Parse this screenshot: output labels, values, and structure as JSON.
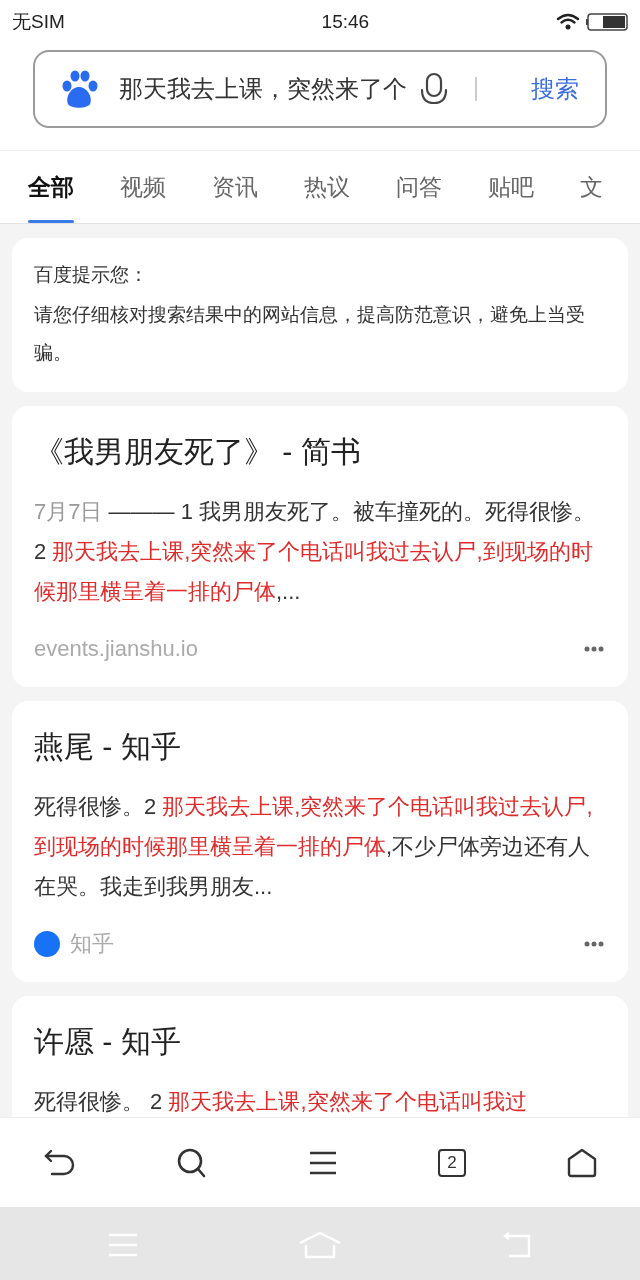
{
  "status_bar": {
    "carrier": "无SIM",
    "time": "15:46"
  },
  "search": {
    "value": "那天我去上课，突然来了个",
    "button": "搜索"
  },
  "tabs": [
    {
      "label": "全部",
      "selected": true
    },
    {
      "label": "视频",
      "selected": false
    },
    {
      "label": "资讯",
      "selected": false
    },
    {
      "label": "热议",
      "selected": false
    },
    {
      "label": "问答",
      "selected": false
    },
    {
      "label": "贴吧",
      "selected": false
    },
    {
      "label": "文",
      "selected": false
    }
  ],
  "notice": {
    "title": "百度提示您：",
    "text": "请您仔细核对搜索结果中的网站信息，提高防范意识，避免上当受骗。"
  },
  "results": [
    {
      "title": "《我男朋友死了》 - 简书",
      "snippet": [
        {
          "text": "7月7日 ",
          "kind": "date"
        },
        {
          "text": "——— 1 我男朋友死了。被车撞死的。死得很惨。2 ",
          "kind": "plain"
        },
        {
          "text": "那天我去上课,突然来了个电话叫我过去认尸,到现场的时候那里横呈着一排的尸体",
          "kind": "highlight"
        },
        {
          "text": ",...",
          "kind": "plain"
        }
      ],
      "source": {
        "kind": "url",
        "text": "events.jianshu.io"
      }
    },
    {
      "title": "燕尾 - 知乎",
      "snippet": [
        {
          "text": "死得很惨。2 ",
          "kind": "plain"
        },
        {
          "text": "那天我去上课,突然来了个电话叫我过去认尸,到现场的时候那里横呈着一排的尸体",
          "kind": "highlight"
        },
        {
          "text": ",不少尸体旁边还有人在哭。我走到我男朋友...",
          "kind": "plain"
        }
      ],
      "source": {
        "kind": "site",
        "text": "知乎"
      }
    },
    {
      "title": "许愿 - 知乎",
      "snippet": [
        {
          "text": "死得很惨。 2 ",
          "kind": "plain"
        },
        {
          "text": "那天我去上课,突然来了个电话叫我过",
          "kind": "highlight"
        }
      ]
    }
  ],
  "toolbar": {
    "tab_count": "2"
  }
}
